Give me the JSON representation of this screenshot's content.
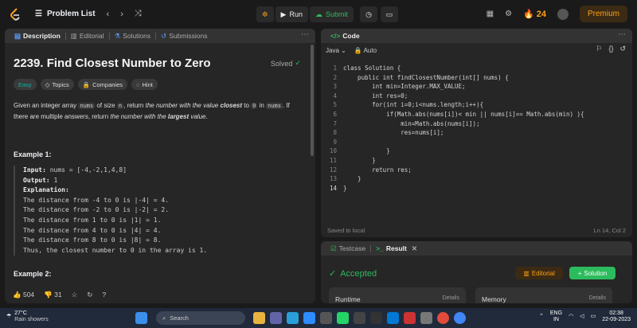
{
  "nav": {
    "problem_list": "Problem List",
    "run": "Run",
    "submit": "Submit",
    "streak": "24",
    "premium": "Premium"
  },
  "left_tabs": [
    "Description",
    "Editorial",
    "Solutions",
    "Submissions"
  ],
  "problem": {
    "title": "2239. Find Closest Number to Zero",
    "status": "Solved",
    "tags": [
      "Easy",
      "Topics",
      "Companies",
      "Hint"
    ],
    "desc_1": "Given an integer array ",
    "desc_code_1": "nums",
    "desc_2": " of size ",
    "desc_code_2": "n",
    "desc_3": ", return ",
    "desc_em_1": "the number with the value",
    "desc_strong_1": "closest",
    "desc_4": " to ",
    "desc_code_3": "0",
    "desc_5": " in",
    "desc_code_4": "nums",
    "desc_6": ". If there are multiple answers, return ",
    "desc_em_2": "the number with the",
    "desc_strong_2": "largest",
    "desc_em_3": "value",
    "desc_7": ".",
    "example1_title": "Example 1:",
    "example1": {
      "input_label": "Input:",
      "input": "nums = [-4,-2,1,4,8]",
      "output_label": "Output:",
      "output": "1",
      "explanation_label": "Explanation:",
      "lines": [
        "The distance from -4 to 0 is |-4| = 4.",
        "The distance from -2 to 0 is |-2| = 2.",
        "The distance from 1 to 0 is |1| = 1.",
        "The distance from 4 to 0 is |4| = 4.",
        "The distance from 8 to 0 is |8| = 8.",
        "Thus, the closest number to 0 in the array is 1."
      ]
    },
    "example2_title": "Example 2:",
    "likes": "504",
    "comments": "31"
  },
  "code_panel": {
    "title": "Code",
    "language": "Java",
    "auto": "Auto",
    "lines": [
      "class Solution {",
      "    public int findClosestNumber(int[] nums) {",
      "        int min=Integer.MAX_VALUE;",
      "        int res=0;",
      "        for(int i=0;i<nums.length;i++){",
      "            if(Math.abs(nums[i])< min || nums[i]== Math.abs(min) ){",
      "                min=Math.abs(nums[i]);",
      "                res=nums[i];",
      "",
      "            }",
      "        }",
      "        return res;",
      "    }",
      "}"
    ],
    "line_numbers": [
      "1",
      "2",
      "3",
      "4",
      "5",
      "6",
      "7",
      "8",
      "9",
      "10",
      "11",
      "12",
      "13",
      "14"
    ],
    "saved": "Saved to local",
    "cursor": "Ln 14, Col 2"
  },
  "test_panel": {
    "tabs": [
      "Testcase",
      "Result"
    ],
    "status": "Accepted",
    "editorial": "Editorial",
    "solution": "Solution",
    "runtime": "Runtime",
    "memory": "Memory",
    "details": "Details"
  },
  "taskbar": {
    "temp": "27°C",
    "weather": "Rain showers",
    "search": "Search",
    "lang_1": "ENG",
    "lang_2": "IN",
    "time": "02:38",
    "date": "22-09-2023"
  },
  "colors": {
    "accent": "#ffa116",
    "green": "#2cbb5d",
    "easy": "#00b8a3"
  }
}
